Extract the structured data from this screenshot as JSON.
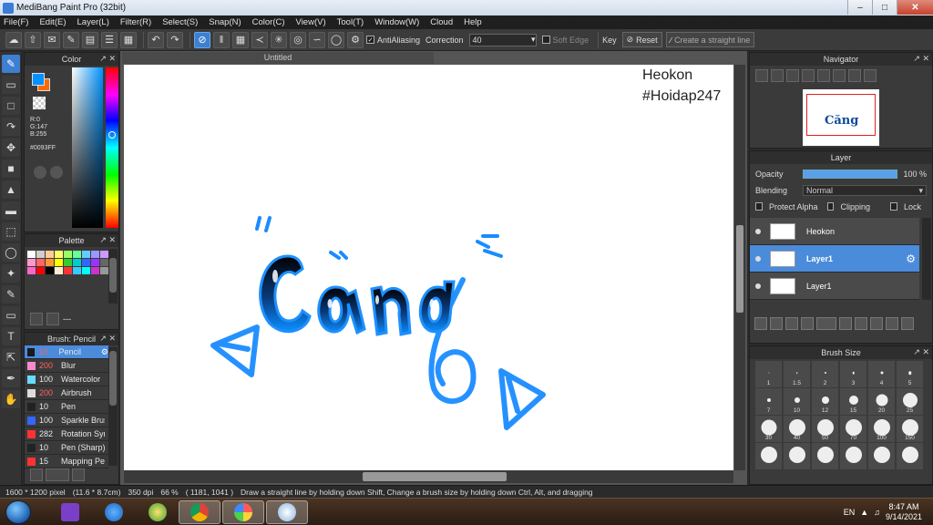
{
  "window": {
    "title": "MediBang Paint Pro (32bit)"
  },
  "menu": [
    "File(F)",
    "Edit(E)",
    "Layer(L)",
    "Filter(R)",
    "Select(S)",
    "Snap(N)",
    "Color(C)",
    "View(V)",
    "Tool(T)",
    "Window(W)",
    "Cloud",
    "Help"
  ],
  "toolbar": {
    "antialiasing_label": "AntiAliasing",
    "correction_label": "Correction",
    "correction_value": "40",
    "soft_edge_label": "Soft Edge",
    "key_label": "Key",
    "reset_label": "Reset",
    "straight_line_label": "Create a straight line"
  },
  "color_panel": {
    "title": "Color",
    "r": "R:0",
    "g": "G:147",
    "b": "B:255",
    "hex": "#0093FF",
    "main_color": "#0093ff",
    "sub_color": "#ff6a00"
  },
  "palette": {
    "title": "Palette",
    "colors": [
      "#ffffff",
      "#cfcfcf",
      "#ffcc99",
      "#ffff66",
      "#99ff66",
      "#66ff99",
      "#66ccff",
      "#9999ff",
      "#cc99ff",
      "#ff99cc",
      "#ff6666",
      "#ff9933",
      "#ffff00",
      "#33cc33",
      "#00cccc",
      "#3366ff",
      "#9933ff",
      "#666666",
      "#ff66cc",
      "#ff0000",
      "#000000",
      "#ffeecc",
      "#ff3333",
      "#33ccff",
      "#00ffff",
      "#cc33cc",
      "#999999"
    ],
    "footer_label": "---"
  },
  "brush_panel": {
    "title": "Brush: Pencil",
    "items": [
      {
        "size": "10",
        "name": "Pencil",
        "color": "#1a1a1a",
        "red": true
      },
      {
        "size": "200",
        "name": "Blur",
        "color": "#ff88cc",
        "red": true
      },
      {
        "size": "100",
        "name": "Watercolor",
        "color": "#66ddff",
        "red": false
      },
      {
        "size": "200",
        "name": "Airbrush",
        "color": "#dddddd",
        "red": true
      },
      {
        "size": "10",
        "name": "Pen",
        "color": "#222222",
        "red": false
      },
      {
        "size": "100",
        "name": "Sparkle Brush",
        "color": "#3366ff",
        "red": false
      },
      {
        "size": "282",
        "name": "Rotation Sym",
        "color": "#ff3333",
        "red": false
      },
      {
        "size": "10",
        "name": "Pen (Sharp)",
        "color": "#222222",
        "red": false
      },
      {
        "size": "15",
        "name": "Mapping Pen",
        "color": "#ff3333",
        "red": false
      }
    ]
  },
  "document": {
    "tab_title": "Untitled",
    "watermark_line1": "Heokon",
    "watermark_line2": "#Hoidap247"
  },
  "navigator": {
    "title": "Navigator"
  },
  "layer_panel": {
    "title": "Layer",
    "opacity_label": "Opacity",
    "opacity_value": "100 %",
    "blending_label": "Blending",
    "blending_value": "Normal",
    "protect_alpha": "Protect Alpha",
    "clipping": "Clipping",
    "lock": "Lock",
    "layers": [
      {
        "name": "Heokon",
        "selected": false
      },
      {
        "name": "Layer1",
        "selected": true
      },
      {
        "name": "Layer1",
        "selected": false
      }
    ]
  },
  "brush_size": {
    "title": "Brush Size",
    "sizes": [
      "1",
      "1.5",
      "2",
      "3",
      "4",
      "5",
      "7",
      "10",
      "12",
      "15",
      "20",
      "25",
      "30",
      "40",
      "50",
      "70",
      "100",
      "150",
      "",
      "",
      "",
      "",
      "",
      ""
    ]
  },
  "status": {
    "dims": "1600 * 1200 pixel",
    "cm": "(11.6 * 8.7cm)",
    "dpi": "350 dpi",
    "zoom": "66 %",
    "coords": "( 1181, 1041 )",
    "hint": "Draw a straight line by holding down Shift, Change a brush size by holding down Ctrl, Alt, and dragging"
  },
  "taskbar": {
    "lang": "EN",
    "time": "8:47 AM",
    "date": "9/14/2021"
  }
}
